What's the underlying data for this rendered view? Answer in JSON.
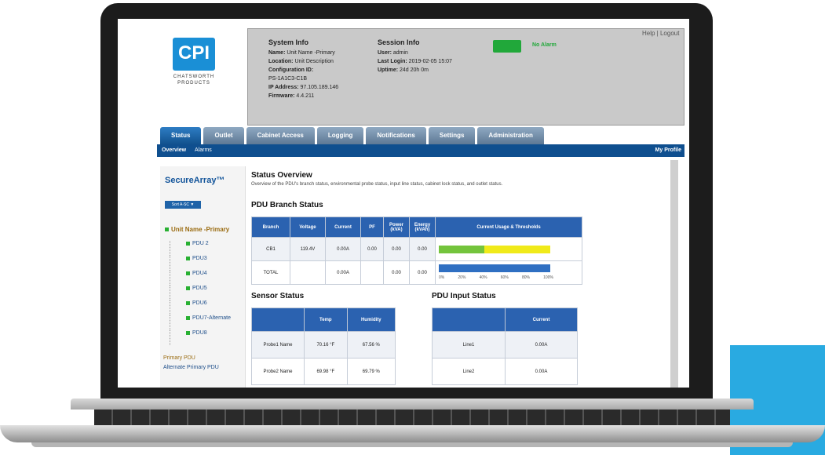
{
  "header": {
    "logo_letters": "CPI",
    "logo_line1": "CHATSWORTH",
    "logo_line2": "PRODUCTS",
    "help_logout": "Help | Logout"
  },
  "system_info": {
    "title": "System Info",
    "name_label": "Name:",
    "name": "Unit Name -Primary",
    "location_label": "Location:",
    "location": "Unit Description",
    "config_label": "Configuration ID:",
    "config": "PS-1A1C3-C1B",
    "ip_label": "IP Address:",
    "ip": "97.105.189.146",
    "firmware_label": "Firmware:",
    "firmware": "4.4.211"
  },
  "session_info": {
    "title": "Session Info",
    "user_label": "User:",
    "user": "admin",
    "last_login_label": "Last Login:",
    "last_login": "2019-02-05 15:07",
    "uptime_label": "Uptime:",
    "uptime": "24d 20h 0m"
  },
  "alarm": {
    "label": "No Alarm",
    "color": "#21a83a"
  },
  "tabs": [
    {
      "label": "Status"
    },
    {
      "label": "Outlet"
    },
    {
      "label": "Cabinet Access"
    },
    {
      "label": "Logging"
    },
    {
      "label": "Notifications"
    },
    {
      "label": "Settings"
    },
    {
      "label": "Administration"
    }
  ],
  "subnav": {
    "overview": "Overview",
    "alarms": "Alarms",
    "profile": "My Profile"
  },
  "sidebar": {
    "title": "SecureArray™",
    "sort_label": "Sort A-SC ▼",
    "root": "Unit Name -Primary",
    "items": [
      "PDU 2",
      "PDU3",
      "PDU4",
      "PDU5",
      "PDU6",
      "PDU7-Alternate",
      "PDU8"
    ],
    "primary_pdu": "Primary PDU",
    "alternate_pdu": "Alternate Primary PDU"
  },
  "content": {
    "title": "Status Overview",
    "description": "Overview of the PDU's branch status, environmental probe status, input line status, cabinet lock status, and outlet status.",
    "branch_title": "PDU Branch Status",
    "branch_headers": [
      "Branch",
      "Voltage",
      "Current",
      "PF",
      "Power (kVA)",
      "Energy (kVAh)",
      "Current Usage & Thresholds"
    ],
    "branch_rows": [
      {
        "branch": "CB1",
        "voltage": "119.4V",
        "current": "0.00A",
        "pf": "0.00",
        "power": "0.00",
        "energy": "0.00",
        "green": 0.4,
        "yellow": 0.6
      },
      {
        "branch": "TOTAL",
        "voltage": "",
        "current": "0.00A",
        "pf": "",
        "power": "0.00",
        "energy": "0.00",
        "blue": 1.0
      }
    ],
    "scale": [
      "0%",
      "20%",
      "40%",
      "60%",
      "80%",
      "100%"
    ],
    "sensor_title": "Sensor Status",
    "sensor_headers": [
      "",
      "Temp",
      "Humidity"
    ],
    "sensor_rows": [
      {
        "name": "Probe1 Name",
        "temp": "70.16 °F",
        "hum": "67.56 %"
      },
      {
        "name": "Probe2 Name",
        "temp": "69.98 °F",
        "hum": "69.79 %"
      }
    ],
    "input_title": "PDU Input Status",
    "input_headers": [
      "",
      "Current"
    ],
    "input_rows": [
      {
        "line": "Line1",
        "current": "0.00A"
      },
      {
        "line": "Line2",
        "current": "0.00A"
      }
    ]
  }
}
